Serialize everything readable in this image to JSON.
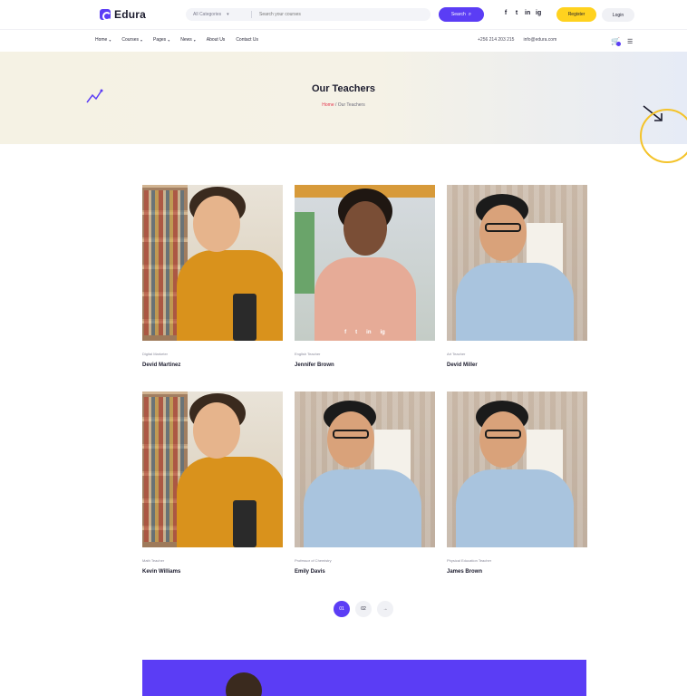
{
  "header": {
    "logo_text": "Edura",
    "search": {
      "category": "All Categories",
      "placeholder": "Search your courses",
      "button_label": "Search"
    },
    "socials": [
      "f",
      "t",
      "in",
      "ig"
    ],
    "register_label": "Register",
    "login_label": "Login"
  },
  "nav": {
    "items": [
      {
        "label": "Home",
        "dropdown": true
      },
      {
        "label": "Courses",
        "dropdown": true
      },
      {
        "label": "Pages",
        "dropdown": true
      },
      {
        "label": "News",
        "dropdown": true
      },
      {
        "label": "About Us",
        "dropdown": false
      },
      {
        "label": "Contact Us",
        "dropdown": false
      }
    ],
    "phone": "+256 214 203 215",
    "email": "info@edura.com"
  },
  "hero": {
    "title": "Our Teachers",
    "breadcrumb_home": "Home",
    "breadcrumb_current": "Our Teachers"
  },
  "teachers": [
    {
      "role": "Digital Marketer",
      "name": "Devid Martinez"
    },
    {
      "role": "English Teacher",
      "name": "Jennifer Brown"
    },
    {
      "role": "Art Teacher",
      "name": "Devid Miller"
    },
    {
      "role": "Math Teacher",
      "name": "Kevin Williams"
    },
    {
      "role": "Professor of Chemistry",
      "name": "Emily Davis"
    },
    {
      "role": "Physical Education Teacher",
      "name": "James Brown"
    }
  ],
  "pagination": {
    "pages": [
      "01",
      "02",
      "→"
    ],
    "active": 0
  },
  "colors": {
    "primary": "#5b3df5",
    "accent": "#ffd21f",
    "breadcrumb_home": "#e4334b"
  }
}
